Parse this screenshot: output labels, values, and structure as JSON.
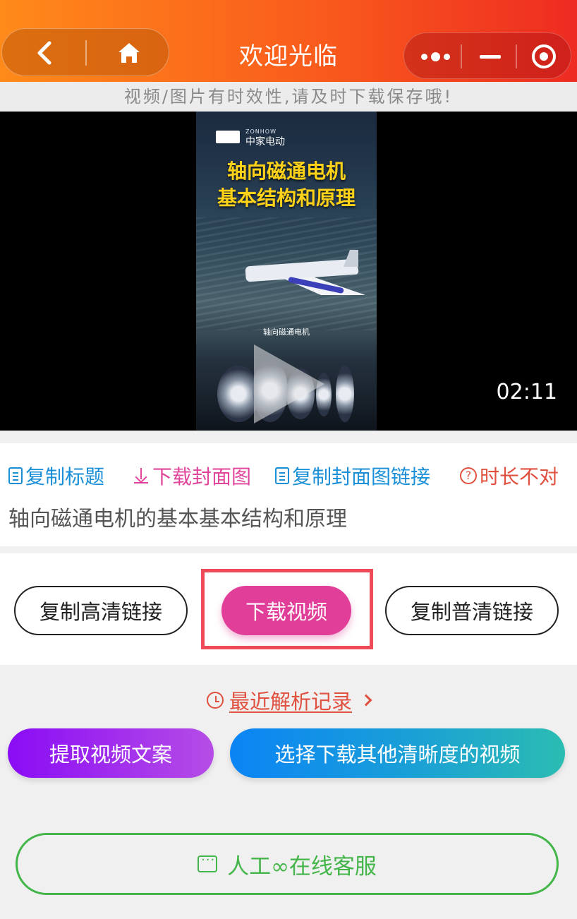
{
  "header": {
    "title": "欢迎光临",
    "icons": {
      "back": "chevron-left-icon",
      "home": "home-icon",
      "more": "more-dots-icon",
      "minimize": "minimize-icon",
      "close": "record-circle-icon"
    },
    "colors": {
      "gradient_start": "#ff8a1a",
      "gradient_end": "#ee2b22"
    }
  },
  "notice": {
    "text": "视频/图片有时效性,请及时下载保存哦!"
  },
  "video": {
    "duration": "02:11",
    "poster": {
      "brand_cn": "中家电动",
      "brand_en": "ZONHOW",
      "title_line1": "轴向磁通电机",
      "title_line2": "基本结构和原理",
      "caption": "轴向磁通电机"
    }
  },
  "info": {
    "actions": {
      "copy_title": "复制标题",
      "download_cover": "下载封面图",
      "copy_cover_link": "复制封面图链接",
      "duration_wrong": "时长不对"
    },
    "title": "轴向磁通电机的基本基本结构和原理",
    "colors": {
      "blue": "#1a8fd8",
      "pink": "#e0459b",
      "red": "#e0503f"
    }
  },
  "buttons": {
    "copy_hd_link": "复制高清链接",
    "download_video": "下载视频",
    "copy_sd_link": "复制普清链接"
  },
  "recent": {
    "label": "最近解析记录"
  },
  "extra": {
    "extract_text": "提取视频文案",
    "choose_quality": "选择下载其他清晰度的视频"
  },
  "service": {
    "label": "人工∞在线客服"
  }
}
